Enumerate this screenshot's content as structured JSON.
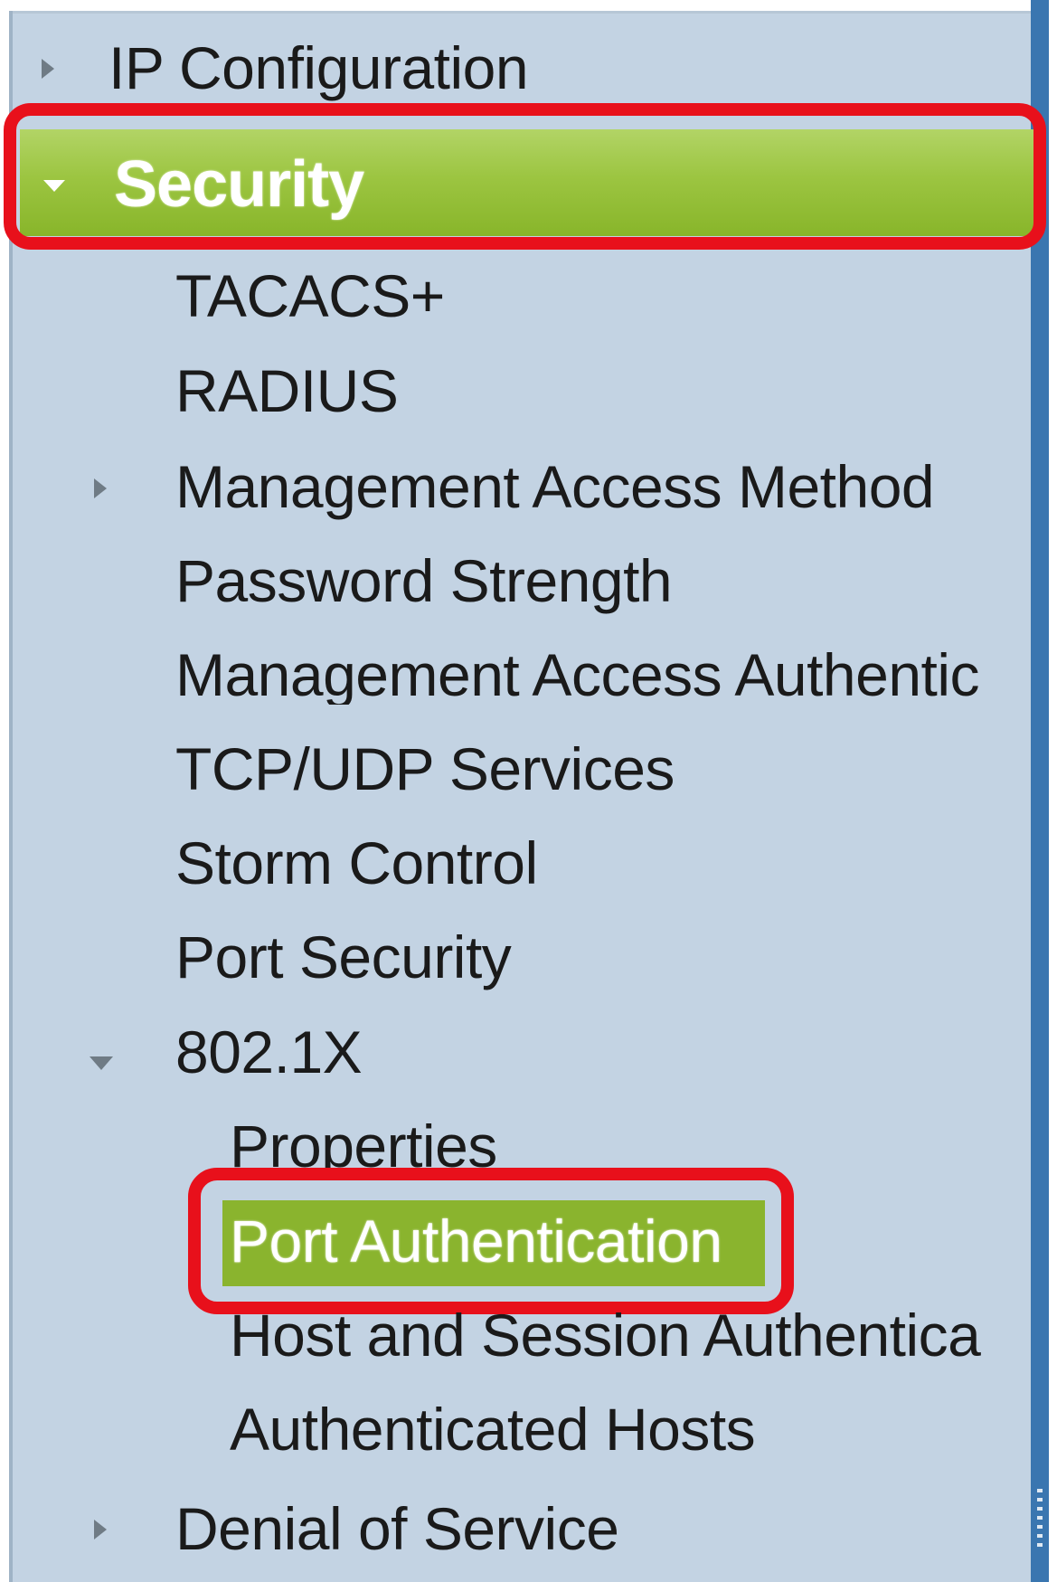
{
  "nav": {
    "ip_configuration": "IP Configuration",
    "security": "Security",
    "tacacs": "TACACS+",
    "radius": "RADIUS",
    "management_access_method": "Management Access Method",
    "password_strength": "Password Strength",
    "management_access_authentication": "Management Access Authentic",
    "tcp_udp_services": "TCP/UDP Services",
    "storm_control": "Storm Control",
    "port_security": "Port Security",
    "dot1x": "802.1X",
    "properties": "Properties",
    "port_authentication": "Port Authentication",
    "host_session_authentication": "Host and Session Authentica",
    "authenticated_hosts": "Authenticated Hosts",
    "denial_of_service": "Denial of Service"
  },
  "icons": {
    "collapsed": "triangle-right-icon",
    "expanded": "triangle-down-icon"
  },
  "colors": {
    "panel_bg": "#c3d3e3",
    "selected_green": "#8ab42e",
    "highlight_red": "#e8101b",
    "scroll_edge_blue": "#3a76b0"
  }
}
